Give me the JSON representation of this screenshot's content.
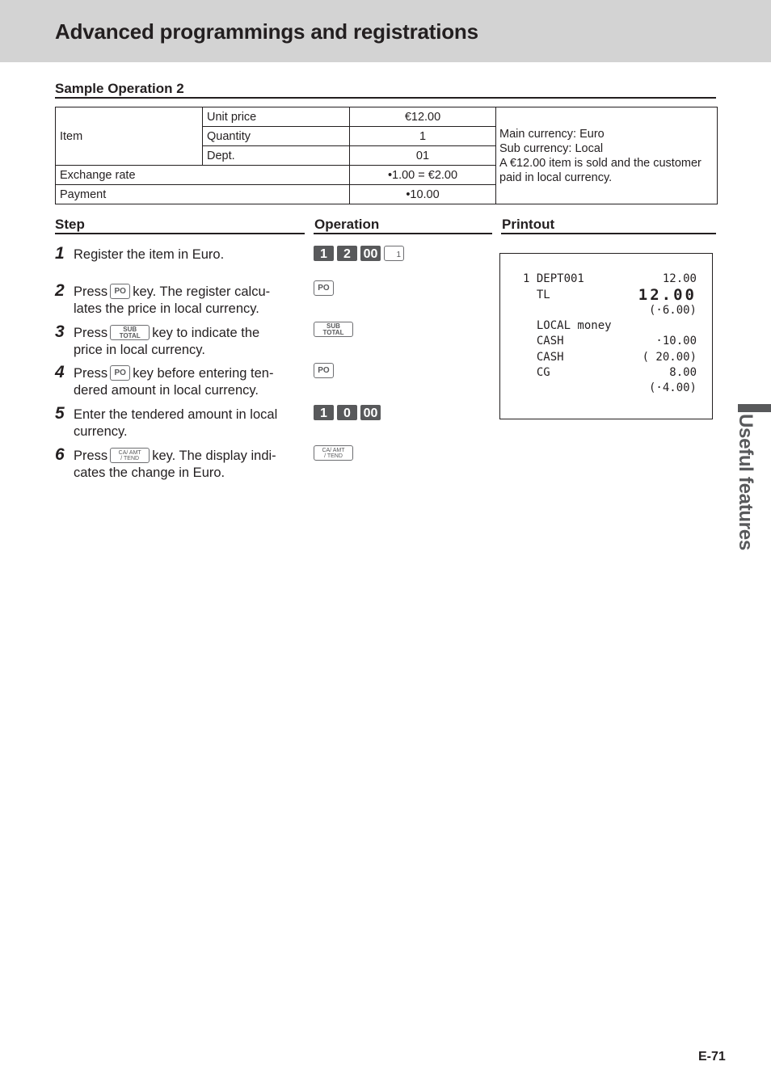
{
  "header": {
    "title": "Advanced programmings and registrations"
  },
  "section": {
    "title": "Sample Operation 2"
  },
  "sample_table": {
    "item_label": "Item",
    "rows": [
      {
        "label": "Unit price",
        "value": "€12.00"
      },
      {
        "label": "Quantity",
        "value": "1"
      },
      {
        "label": "Dept.",
        "value": "01"
      }
    ],
    "exchange_rate": {
      "label": "Exchange rate",
      "value": "•1.00 = €2.00"
    },
    "payment": {
      "label": "Payment",
      "value": "•10.00"
    },
    "note": [
      "Main currency: Euro",
      "Sub currency: Local",
      "A €12.00 item is sold and the customer",
      "paid in local currency."
    ]
  },
  "columns": {
    "step": "Step",
    "operation": "Operation",
    "printout": "Printout"
  },
  "steps": [
    {
      "num": "1",
      "before": "Register the item in Euro.",
      "key": "",
      "after": ""
    },
    {
      "num": "2",
      "before": "Press",
      "key": "PO",
      "after": "key. The register calcu-lates the price in local currency."
    },
    {
      "num": "3",
      "before": "Press",
      "key": "SUB TOTAL",
      "after": "key to indicate the price in local currency."
    },
    {
      "num": "4",
      "before": "Press",
      "key": "PO",
      "after": "key before entering ten-dered amount in local currency."
    },
    {
      "num": "5",
      "before": "Enter the tendered amount in local currency.",
      "key": "",
      "after": ""
    },
    {
      "num": "6",
      "before": "Press",
      "key": "CA/AMT/TEND",
      "after": "key. The display indi-cates the change in Euro."
    }
  ],
  "keys": {
    "po": "PO",
    "sub_1": "SUB",
    "sub_2": "TOTAL",
    "ca_1": "CA/ AMT",
    "ca_2": "/ TEND",
    "dept": "1"
  },
  "operations": {
    "op1": [
      "1",
      "2",
      "00"
    ],
    "op5": [
      "1",
      "0",
      "00"
    ]
  },
  "printout": [
    {
      "left": "1 DEPT001",
      "right": "12.00"
    },
    {
      "left": "  TL",
      "right": "12.00",
      "big": true
    },
    {
      "left": "",
      "right": "(·6.00)"
    },
    {
      "left": "  LOCAL money",
      "right": ""
    },
    {
      "left": "  CASH",
      "right": "·10.00"
    },
    {
      "left": "  CASH",
      "right": "( 20.00)"
    },
    {
      "left": "  CG",
      "right": "8.00"
    },
    {
      "left": "",
      "right": "(·4.00)"
    }
  ],
  "side_tab": {
    "label": "Useful features"
  },
  "footer": {
    "page_number": "E-71"
  }
}
